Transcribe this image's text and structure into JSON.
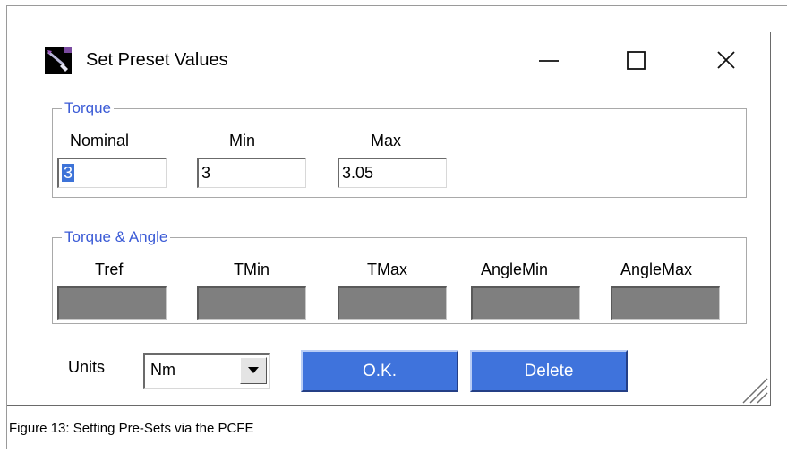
{
  "window": {
    "title": "Set Preset Values",
    "icons": {
      "app": "wrench-app-icon",
      "minimize": "minimize-icon",
      "maximize": "maximize-icon",
      "close": "close-icon"
    }
  },
  "torque": {
    "legend": "Torque",
    "nominal": {
      "label": "Nominal",
      "value": "3"
    },
    "min": {
      "label": "Min",
      "value": "3"
    },
    "max": {
      "label": "Max",
      "value": "3.05"
    }
  },
  "torque_angle": {
    "legend": "Torque & Angle",
    "fields": [
      {
        "label": "Tref",
        "value": ""
      },
      {
        "label": "TMin",
        "value": ""
      },
      {
        "label": "TMax",
        "value": ""
      },
      {
        "label": "AngleMin",
        "value": ""
      },
      {
        "label": "AngleMax",
        "value": ""
      }
    ]
  },
  "units": {
    "label": "Units",
    "selected": "Nm"
  },
  "buttons": {
    "ok": "O.K.",
    "delete": "Delete"
  },
  "caption": {
    "figure": "Figure 13:",
    "text": "Setting Pre-Sets via the PCFE"
  },
  "colors": {
    "accent_button": "#3f73dc",
    "legend_text": "#3b5bd6",
    "disabled_field": "#7f7f7f",
    "selection": "#3d73d8"
  }
}
